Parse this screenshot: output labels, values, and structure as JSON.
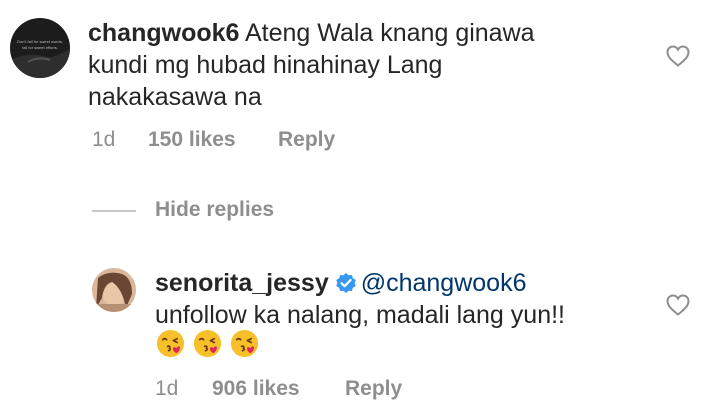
{
  "comments": [
    {
      "username": "changwook6",
      "text_line1": "Ateng Wala knang ginawa",
      "text_line2": "kundi mg hubad hinahinay Lang",
      "text_line3": "nakakasawa na",
      "time": "1d",
      "likes": "150 likes",
      "reply_label": "Reply",
      "avatar_caption_line1": "Don't fall for sweet words,",
      "avatar_caption_line2": "fall for sweet efforts."
    }
  ],
  "hide_replies_label": "Hide replies",
  "reply": {
    "username": "senorita_jessy",
    "verified": true,
    "mention": "@changwook6",
    "text": "unfollow ka nalang, madali lang yun!!",
    "emojis": [
      "kissing-face-with-heart",
      "kissing-face-with-heart",
      "kissing-face-with-heart"
    ],
    "time": "1d",
    "likes": "906 likes",
    "reply_label": "Reply"
  },
  "colors": {
    "text": "#262626",
    "meta": "#8e8e8e",
    "mention": "#00376b",
    "verified": "#3897f0"
  }
}
